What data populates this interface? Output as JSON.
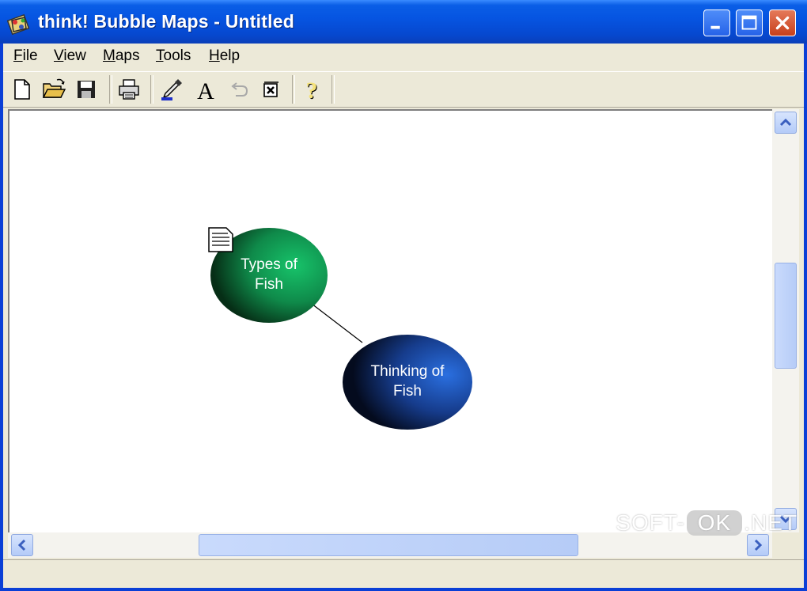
{
  "window": {
    "title": "think! Bubble Maps - Untitled",
    "accent": "#0a5ee6"
  },
  "menu": [
    {
      "ul": "F",
      "rest": "ile"
    },
    {
      "ul": "V",
      "rest": "iew"
    },
    {
      "ul": "M",
      "rest": "aps"
    },
    {
      "ul": "T",
      "rest": "ools"
    },
    {
      "ul": "H",
      "rest": "elp"
    }
  ],
  "toolbar": {
    "buttons": [
      "new-document-icon",
      "open-folder-icon",
      "save-disk-icon",
      "print-icon",
      "dropper-color-icon",
      "font-icon",
      "undo-icon",
      "delete-icon",
      "help-icon"
    ]
  },
  "map": {
    "bubbles": [
      {
        "line1": "Types of",
        "line2": "Fish",
        "color": "#1a9c5a"
      },
      {
        "line1": "Thinking of",
        "line2": "Fish",
        "color": "#1b4fb0"
      }
    ]
  },
  "watermark": {
    "pre": "SOFT-",
    "ok": "OK",
    "post": ".NET"
  }
}
